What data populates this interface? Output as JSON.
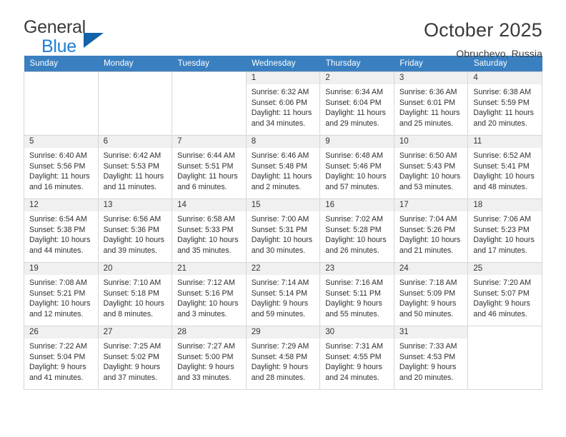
{
  "brand": {
    "word1": "General",
    "word2": "Blue",
    "logo_icon": "triangle-logo"
  },
  "header": {
    "title": "October 2025",
    "location": "Obruchevo, Russia"
  },
  "calendar": {
    "weekday_headers": [
      "Sunday",
      "Monday",
      "Tuesday",
      "Wednesday",
      "Thursday",
      "Friday",
      "Saturday"
    ],
    "labels": {
      "sunrise": "Sunrise:",
      "sunset": "Sunset:",
      "daylight": "Daylight:"
    },
    "weeks": [
      [
        {
          "day": "",
          "blank": true
        },
        {
          "day": "",
          "blank": true
        },
        {
          "day": "",
          "blank": true
        },
        {
          "day": "1",
          "sunrise": "Sunrise: 6:32 AM",
          "sunset": "Sunset: 6:06 PM",
          "daylight_1": "Daylight: 11 hours",
          "daylight_2": "and 34 minutes."
        },
        {
          "day": "2",
          "sunrise": "Sunrise: 6:34 AM",
          "sunset": "Sunset: 6:04 PM",
          "daylight_1": "Daylight: 11 hours",
          "daylight_2": "and 29 minutes."
        },
        {
          "day": "3",
          "sunrise": "Sunrise: 6:36 AM",
          "sunset": "Sunset: 6:01 PM",
          "daylight_1": "Daylight: 11 hours",
          "daylight_2": "and 25 minutes."
        },
        {
          "day": "4",
          "sunrise": "Sunrise: 6:38 AM",
          "sunset": "Sunset: 5:59 PM",
          "daylight_1": "Daylight: 11 hours",
          "daylight_2": "and 20 minutes."
        }
      ],
      [
        {
          "day": "5",
          "sunrise": "Sunrise: 6:40 AM",
          "sunset": "Sunset: 5:56 PM",
          "daylight_1": "Daylight: 11 hours",
          "daylight_2": "and 16 minutes."
        },
        {
          "day": "6",
          "sunrise": "Sunrise: 6:42 AM",
          "sunset": "Sunset: 5:53 PM",
          "daylight_1": "Daylight: 11 hours",
          "daylight_2": "and 11 minutes."
        },
        {
          "day": "7",
          "sunrise": "Sunrise: 6:44 AM",
          "sunset": "Sunset: 5:51 PM",
          "daylight_1": "Daylight: 11 hours",
          "daylight_2": "and 6 minutes."
        },
        {
          "day": "8",
          "sunrise": "Sunrise: 6:46 AM",
          "sunset": "Sunset: 5:48 PM",
          "daylight_1": "Daylight: 11 hours",
          "daylight_2": "and 2 minutes."
        },
        {
          "day": "9",
          "sunrise": "Sunrise: 6:48 AM",
          "sunset": "Sunset: 5:46 PM",
          "daylight_1": "Daylight: 10 hours",
          "daylight_2": "and 57 minutes."
        },
        {
          "day": "10",
          "sunrise": "Sunrise: 6:50 AM",
          "sunset": "Sunset: 5:43 PM",
          "daylight_1": "Daylight: 10 hours",
          "daylight_2": "and 53 minutes."
        },
        {
          "day": "11",
          "sunrise": "Sunrise: 6:52 AM",
          "sunset": "Sunset: 5:41 PM",
          "daylight_1": "Daylight: 10 hours",
          "daylight_2": "and 48 minutes."
        }
      ],
      [
        {
          "day": "12",
          "sunrise": "Sunrise: 6:54 AM",
          "sunset": "Sunset: 5:38 PM",
          "daylight_1": "Daylight: 10 hours",
          "daylight_2": "and 44 minutes."
        },
        {
          "day": "13",
          "sunrise": "Sunrise: 6:56 AM",
          "sunset": "Sunset: 5:36 PM",
          "daylight_1": "Daylight: 10 hours",
          "daylight_2": "and 39 minutes."
        },
        {
          "day": "14",
          "sunrise": "Sunrise: 6:58 AM",
          "sunset": "Sunset: 5:33 PM",
          "daylight_1": "Daylight: 10 hours",
          "daylight_2": "and 35 minutes."
        },
        {
          "day": "15",
          "sunrise": "Sunrise: 7:00 AM",
          "sunset": "Sunset: 5:31 PM",
          "daylight_1": "Daylight: 10 hours",
          "daylight_2": "and 30 minutes."
        },
        {
          "day": "16",
          "sunrise": "Sunrise: 7:02 AM",
          "sunset": "Sunset: 5:28 PM",
          "daylight_1": "Daylight: 10 hours",
          "daylight_2": "and 26 minutes."
        },
        {
          "day": "17",
          "sunrise": "Sunrise: 7:04 AM",
          "sunset": "Sunset: 5:26 PM",
          "daylight_1": "Daylight: 10 hours",
          "daylight_2": "and 21 minutes."
        },
        {
          "day": "18",
          "sunrise": "Sunrise: 7:06 AM",
          "sunset": "Sunset: 5:23 PM",
          "daylight_1": "Daylight: 10 hours",
          "daylight_2": "and 17 minutes."
        }
      ],
      [
        {
          "day": "19",
          "sunrise": "Sunrise: 7:08 AM",
          "sunset": "Sunset: 5:21 PM",
          "daylight_1": "Daylight: 10 hours",
          "daylight_2": "and 12 minutes."
        },
        {
          "day": "20",
          "sunrise": "Sunrise: 7:10 AM",
          "sunset": "Sunset: 5:18 PM",
          "daylight_1": "Daylight: 10 hours",
          "daylight_2": "and 8 minutes."
        },
        {
          "day": "21",
          "sunrise": "Sunrise: 7:12 AM",
          "sunset": "Sunset: 5:16 PM",
          "daylight_1": "Daylight: 10 hours",
          "daylight_2": "and 3 minutes."
        },
        {
          "day": "22",
          "sunrise": "Sunrise: 7:14 AM",
          "sunset": "Sunset: 5:14 PM",
          "daylight_1": "Daylight: 9 hours",
          "daylight_2": "and 59 minutes."
        },
        {
          "day": "23",
          "sunrise": "Sunrise: 7:16 AM",
          "sunset": "Sunset: 5:11 PM",
          "daylight_1": "Daylight: 9 hours",
          "daylight_2": "and 55 minutes."
        },
        {
          "day": "24",
          "sunrise": "Sunrise: 7:18 AM",
          "sunset": "Sunset: 5:09 PM",
          "daylight_1": "Daylight: 9 hours",
          "daylight_2": "and 50 minutes."
        },
        {
          "day": "25",
          "sunrise": "Sunrise: 7:20 AM",
          "sunset": "Sunset: 5:07 PM",
          "daylight_1": "Daylight: 9 hours",
          "daylight_2": "and 46 minutes."
        }
      ],
      [
        {
          "day": "26",
          "sunrise": "Sunrise: 7:22 AM",
          "sunset": "Sunset: 5:04 PM",
          "daylight_1": "Daylight: 9 hours",
          "daylight_2": "and 41 minutes."
        },
        {
          "day": "27",
          "sunrise": "Sunrise: 7:25 AM",
          "sunset": "Sunset: 5:02 PM",
          "daylight_1": "Daylight: 9 hours",
          "daylight_2": "and 37 minutes."
        },
        {
          "day": "28",
          "sunrise": "Sunrise: 7:27 AM",
          "sunset": "Sunset: 5:00 PM",
          "daylight_1": "Daylight: 9 hours",
          "daylight_2": "and 33 minutes."
        },
        {
          "day": "29",
          "sunrise": "Sunrise: 7:29 AM",
          "sunset": "Sunset: 4:58 PM",
          "daylight_1": "Daylight: 9 hours",
          "daylight_2": "and 28 minutes."
        },
        {
          "day": "30",
          "sunrise": "Sunrise: 7:31 AM",
          "sunset": "Sunset: 4:55 PM",
          "daylight_1": "Daylight: 9 hours",
          "daylight_2": "and 24 minutes."
        },
        {
          "day": "31",
          "sunrise": "Sunrise: 7:33 AM",
          "sunset": "Sunset: 4:53 PM",
          "daylight_1": "Daylight: 9 hours",
          "daylight_2": "and 20 minutes."
        },
        {
          "day": "",
          "blank": true
        }
      ]
    ]
  },
  "colors": {
    "header_blue": "#3a80c1",
    "brand_blue": "#1f7fd4",
    "logo_blue": "#1263a8",
    "daynum_bg": "#f0f0f0",
    "blank_bg": "#f4f4f4",
    "grid_line": "#d7d7d7"
  }
}
